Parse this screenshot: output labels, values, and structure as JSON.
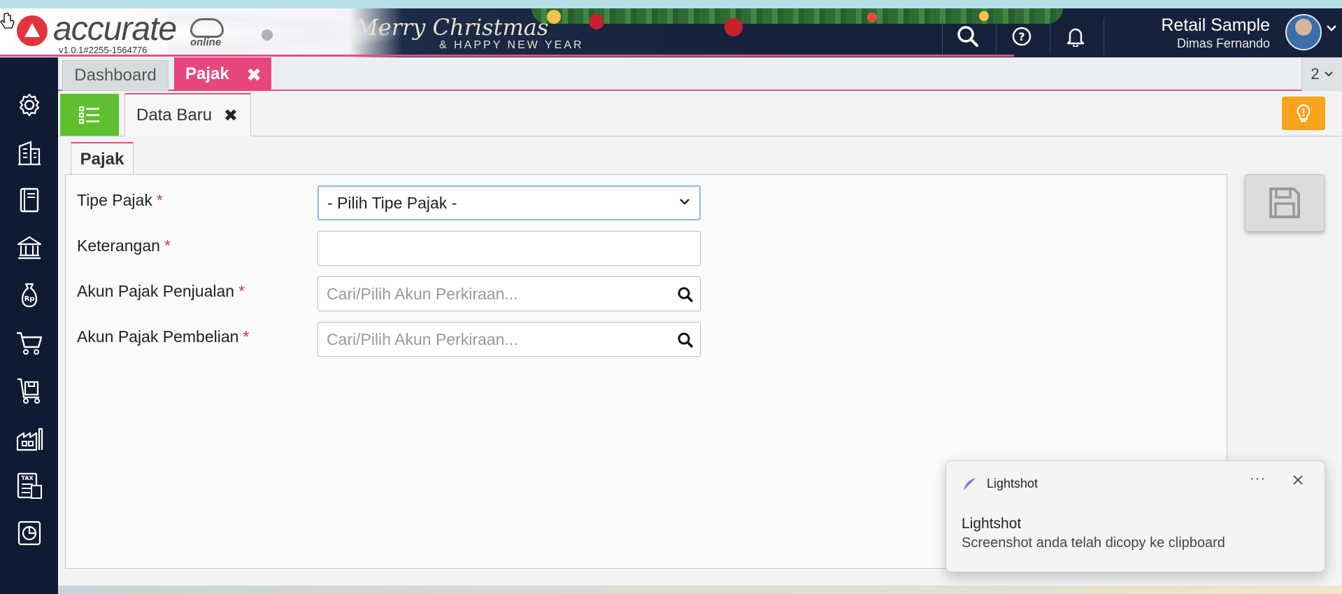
{
  "app": {
    "logo_text": "accurate",
    "logo_sub": "online",
    "version": "v1.0.1#2255-1564776",
    "banner_line1": "Merry Christmas",
    "banner_line2": "& HAPPY NEW YEAR"
  },
  "header": {
    "company": "Retail Sample",
    "user": "Dimas Fernando",
    "icons": [
      "search-icon",
      "help-icon",
      "bell-icon"
    ]
  },
  "sidebar": {
    "items": [
      "gear-icon",
      "building-icon",
      "book-icon",
      "bank-icon",
      "money-bag-icon",
      "cart-icon",
      "purchase-cart-icon",
      "warehouse-icon",
      "tax-icon",
      "report-icon"
    ]
  },
  "tabs": {
    "items": [
      {
        "label": "Dashboard",
        "active": false
      },
      {
        "label": "Pajak",
        "active": true
      }
    ],
    "count": "2"
  },
  "subtabs": {
    "label": "Data Baru"
  },
  "form": {
    "section_tab": "Pajak",
    "required_mark": "*",
    "fields": [
      {
        "label": "Tipe Pajak",
        "value": "- Pilih Tipe Pajak -",
        "kind": "select"
      },
      {
        "label": "Keterangan",
        "value": "",
        "kind": "text"
      },
      {
        "label": "Akun Pajak Penjualan",
        "placeholder": "Cari/Pilih Akun Perkiraan...",
        "kind": "search"
      },
      {
        "label": "Akun Pajak Pembelian",
        "placeholder": "Cari/Pilih Akun Perkiraan...",
        "kind": "search"
      }
    ]
  },
  "toast": {
    "app": "Lightshot",
    "more": "···",
    "title": "Lightshot",
    "body": "Screenshot anda telah dicopy ke clipboard"
  },
  "colors": {
    "accent_pink": "#e8467f",
    "sidebar_bg": "#0f1b33",
    "green": "#5fbf2e",
    "orange": "#f7a31c"
  }
}
